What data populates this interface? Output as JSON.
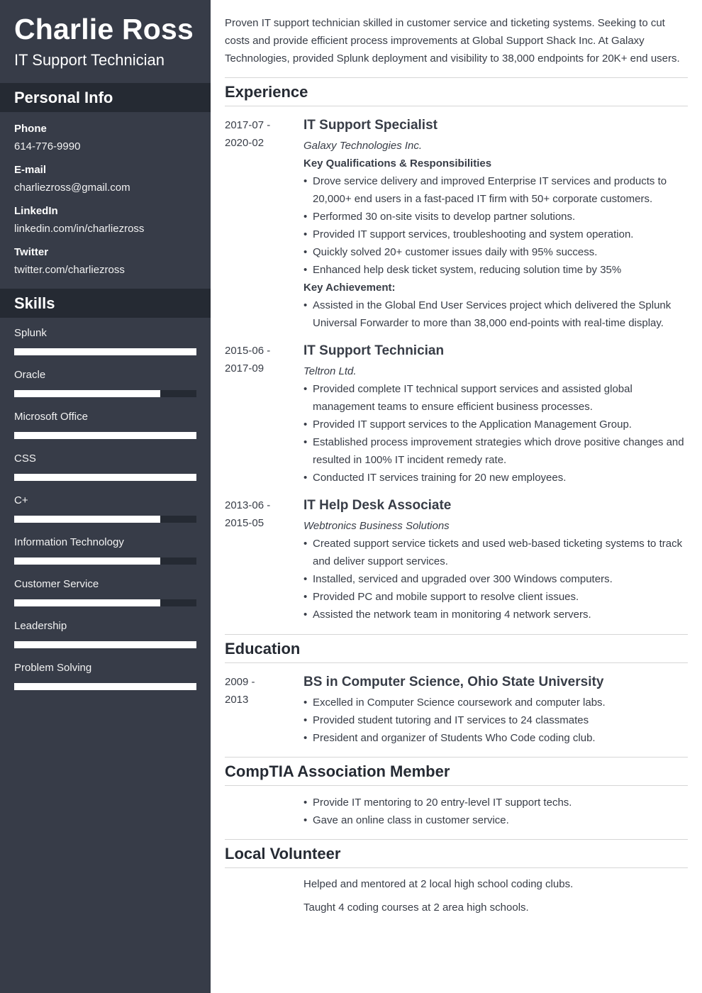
{
  "colors": {
    "sidebar_bg": "#373c48",
    "sidebar_header_bg": "#252a33",
    "bar_fill": "#ffffff",
    "bar_track": "#252a33",
    "text": "#383d47",
    "divider": "#d6d6d6"
  },
  "header": {
    "name": "Charlie Ross",
    "title": "IT Support Technician"
  },
  "personal_info": {
    "title": "Personal Info",
    "items": [
      {
        "label": "Phone",
        "value": "614-776-9990"
      },
      {
        "label": "E-mail",
        "value": "charliezross@gmail.com"
      },
      {
        "label": "LinkedIn",
        "value": "linkedin.com/in/charliezross"
      },
      {
        "label": "Twitter",
        "value": "twitter.com/charliezross"
      }
    ]
  },
  "skills": {
    "title": "Skills",
    "items": [
      {
        "name": "Splunk",
        "level_percent": 100
      },
      {
        "name": "Oracle",
        "level_percent": 80
      },
      {
        "name": "Microsoft Office",
        "level_percent": 100
      },
      {
        "name": "CSS",
        "level_percent": 100
      },
      {
        "name": "C+",
        "level_percent": 80
      },
      {
        "name": "Information Technology",
        "level_percent": 80
      },
      {
        "name": "Customer Service",
        "level_percent": 80
      },
      {
        "name": "Leadership",
        "level_percent": 100
      },
      {
        "name": "Problem Solving",
        "level_percent": 100
      }
    ]
  },
  "summary": "Proven IT support technician skilled in customer service and ticketing systems. Seeking to cut costs and provide efficient process improvements at Global Support Shack Inc. At Galaxy Technologies, provided Splunk deployment and visibility to 38,000 endpoints for 20K+ end users.",
  "experience": {
    "title": "Experience",
    "entries": [
      {
        "date_start": "2017-07 -",
        "date_end": "2020-02",
        "title": "IT Support Specialist",
        "company": "Galaxy Technologies Inc.",
        "sub1": "Key Qualifications & Responsibilities",
        "bullets1": [
          "Drove service delivery and improved Enterprise IT services and products to 20,000+ end users in a fast-paced IT firm with 50+ corporate customers.",
          "Performed 30 on-site visits to develop partner solutions.",
          "Provided IT support services, troubleshooting and system operation.",
          "Quickly solved 20+ customer issues daily with 95% success.",
          "Enhanced help desk ticket system, reducing solution time by 35%"
        ],
        "sub2": "Key Achievement:",
        "bullets2": [
          "Assisted in the Global End User Services project which delivered the Splunk Universal Forwarder to more than 38,000 end-points with real-time display."
        ]
      },
      {
        "date_start": "2015-06 -",
        "date_end": "2017-09",
        "title": "IT Support Technician",
        "company": "Teltron Ltd.",
        "bullets": [
          "Provided complete IT technical support services and assisted global management teams to ensure efficient business processes.",
          "Provided IT support services to the Application Management Group.",
          "Established process improvement strategies which drove positive changes and resulted in 100% IT incident remedy rate.",
          "Conducted IT services training for 20 new employees."
        ]
      },
      {
        "date_start": "2013-06 -",
        "date_end": "2015-05",
        "title": "IT Help Desk Associate",
        "company": "Webtronics Business Solutions",
        "bullets": [
          "Created support service tickets and used web-based ticketing systems to track and deliver support services.",
          "Installed, serviced and upgraded over 300 Windows computers.",
          "Provided PC and mobile support to resolve client issues.",
          "Assisted the network team in monitoring 4 network servers."
        ]
      }
    ]
  },
  "education": {
    "title": "Education",
    "entries": [
      {
        "date_start": "2009 -",
        "date_end": "2013",
        "title": "BS in Computer Science, Ohio State University",
        "bullets": [
          "Excelled in Computer Science coursework and computer labs.",
          "Provided student tutoring and IT services to 24 classmates",
          "President and organizer of Students Who Code coding club."
        ]
      }
    ]
  },
  "comptia": {
    "title": "CompTIA Association Member",
    "bullets": [
      "Provide IT mentoring to 20 entry-level IT support techs.",
      "Gave an online class in customer service."
    ]
  },
  "volunteer": {
    "title": "Local Volunteer",
    "paragraphs": [
      "Helped and mentored at 2 local high school coding clubs.",
      "Taught 4 coding courses at 2 area high schools."
    ]
  }
}
